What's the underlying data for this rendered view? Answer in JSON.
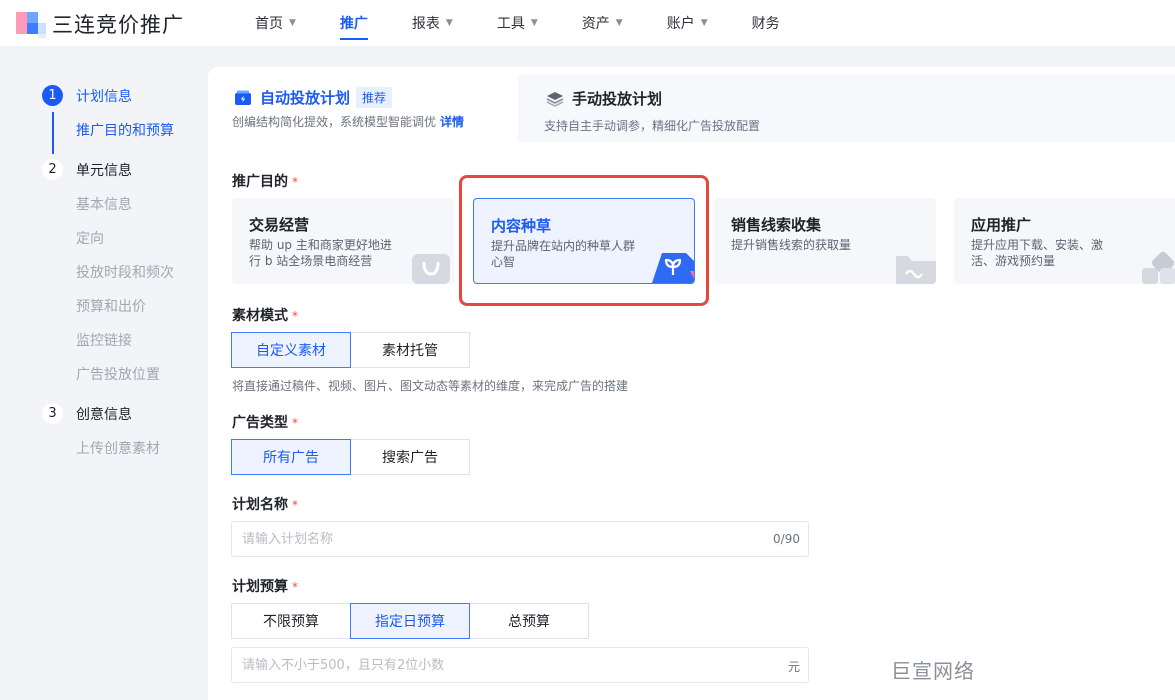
{
  "app": {
    "logo_text": "三连竞价推广"
  },
  "nav": {
    "items": [
      {
        "label": "首页",
        "caret": true
      },
      {
        "label": "推广",
        "caret": false,
        "active": true
      },
      {
        "label": "报表",
        "caret": true
      },
      {
        "label": "工具",
        "caret": true
      },
      {
        "label": "资产",
        "caret": true
      },
      {
        "label": "账户",
        "caret": true
      },
      {
        "label": "财务",
        "caret": false
      }
    ]
  },
  "steps": [
    {
      "num": "1",
      "title": "计划信息",
      "subs": [
        "推广目的和预算"
      ]
    },
    {
      "num": "2",
      "title": "单元信息",
      "subs": [
        "基本信息",
        "定向",
        "投放时段和频次",
        "预算和出价",
        "监控链接",
        "广告投放位置"
      ]
    },
    {
      "num": "3",
      "title": "创意信息",
      "subs": [
        "上传创意素材"
      ]
    }
  ],
  "tabs": {
    "auto": {
      "title": "自动投放计划",
      "badge": "推荐",
      "desc": "创编结构简化提效，系统模型智能调优",
      "detail_link": "详情"
    },
    "manual": {
      "title": "手动投放计划",
      "desc": "支持自主手动调参，精细化广告投放配置"
    }
  },
  "purpose": {
    "label": "推广目的",
    "required_mark": "*",
    "cards": [
      {
        "title": "交易经营",
        "desc": "帮助 up 主和商家更好地进行 b 站全场景电商经营"
      },
      {
        "title": "内容种草",
        "desc": "提升品牌在站内的种草人群心智",
        "selected": true
      },
      {
        "title": "销售线索收集",
        "desc": "提升销售线索的获取量"
      },
      {
        "title": "应用推广",
        "desc": "提升应用下载、安装、激活、游戏预约量"
      }
    ]
  },
  "material": {
    "label": "素材模式",
    "required_mark": "*",
    "options": [
      "自定义素材",
      "素材托管"
    ],
    "selected": "自定义素材",
    "hint": "将直接通过稿件、视频、图片、图文动态等素材的维度，来完成广告的搭建"
  },
  "ad_type": {
    "label": "广告类型",
    "required_mark": "*",
    "options": [
      "所有广告",
      "搜索广告"
    ],
    "selected": "所有广告"
  },
  "plan_name": {
    "label": "计划名称",
    "required_mark": "*",
    "placeholder": "请输入计划名称",
    "counter": "0/90"
  },
  "budget": {
    "label": "计划预算",
    "required_mark": "*",
    "options": [
      "不限预算",
      "指定日预算",
      "总预算"
    ],
    "selected": "指定日预算",
    "placeholder": "请输入不小于500，且只有2位小数",
    "unit": "元"
  },
  "watermark": "巨宣网络",
  "colors": {
    "accent": "#1a5bf5",
    "highlight": "#e8483b",
    "required": "#f54a45"
  }
}
